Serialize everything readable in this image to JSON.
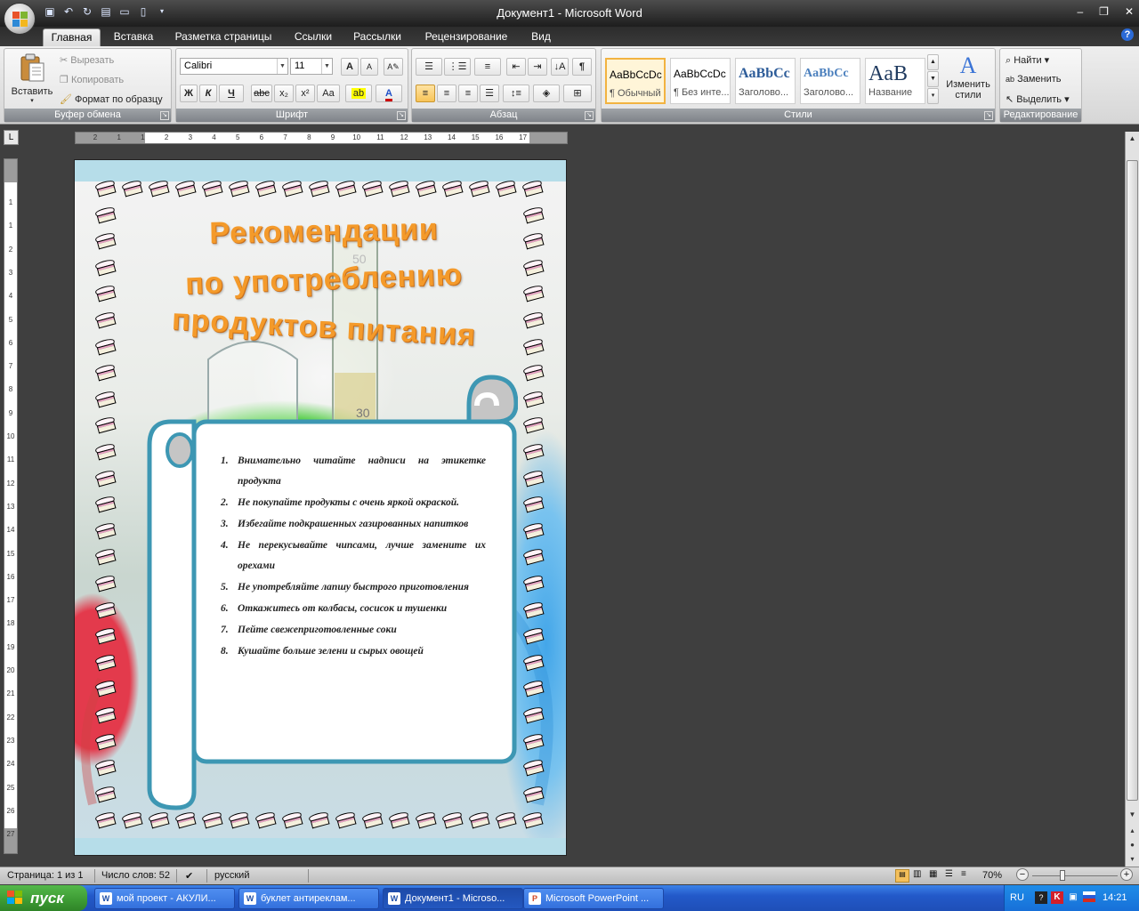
{
  "window": {
    "title": "Документ1 - Microsoft Word",
    "minimize": "–",
    "restore": "❐",
    "close": "✕"
  },
  "qat": {
    "icons": [
      "save-icon",
      "undo-icon",
      "redo-icon",
      "print-icon",
      "open-icon",
      "new-icon"
    ]
  },
  "tabs": [
    "Главная",
    "Вставка",
    "Разметка страницы",
    "Ссылки",
    "Рассылки",
    "Рецензирование",
    "Вид"
  ],
  "ribbon": {
    "clipboard": {
      "paste": "Вставить",
      "cut": "Вырезать",
      "copy": "Копировать",
      "format_painter": "Формат по образцу",
      "label": "Буфер обмена"
    },
    "font": {
      "name": "Calibri",
      "size": "11",
      "label": "Шрифт",
      "bold": "Ж",
      "italic": "К",
      "underline": "Ч",
      "strike": "abc",
      "sub": "x₂",
      "sup": "x²",
      "case": "Aa",
      "grow": "A",
      "shrink": "A"
    },
    "paragraph": {
      "label": "Абзац",
      "pilcrow": "¶"
    },
    "styles": {
      "label": "Стили",
      "items": [
        {
          "preview": "AaBbCcDc",
          "name": "¶ Обычный"
        },
        {
          "preview": "AaBbCcDc",
          "name": "¶ Без инте..."
        },
        {
          "preview": "AaBbCc",
          "name": "Заголово..."
        },
        {
          "preview": "AaBbCc",
          "name": "Заголово..."
        },
        {
          "preview": "AaB",
          "name": "Название"
        }
      ],
      "change": "Изменить стили"
    },
    "editing": {
      "label": "Редактирование",
      "find": "Найти",
      "replace": "Заменить",
      "select": "Выделить"
    }
  },
  "ruler": {
    "h_ticks": [
      "2",
      "1",
      "1",
      "2",
      "3",
      "4",
      "5",
      "6",
      "7",
      "8",
      "9",
      "10",
      "11",
      "12",
      "13",
      "14",
      "15",
      "16",
      "17"
    ],
    "v_ticks": [
      "1",
      "1",
      "2",
      "3",
      "4",
      "5",
      "6",
      "7",
      "8",
      "9",
      "10",
      "11",
      "12",
      "13",
      "14",
      "15",
      "16",
      "17",
      "18",
      "19",
      "20",
      "21",
      "22",
      "23",
      "24",
      "25",
      "26",
      "27"
    ]
  },
  "document": {
    "headline": [
      "Рекомендации",
      "по употреблению",
      "продуктов питания"
    ],
    "list": [
      {
        "num": "1.",
        "text": "Внимательно читайте надписи на этикетке продукта"
      },
      {
        "num": "2.",
        "text": "Не покупайте продукты с очень яркой окраской."
      },
      {
        "num": "3.",
        "text": "Избегайте подкрашенных газированных напитков"
      },
      {
        "num": "4.",
        "text": "Не перекусывайте чипсами, лучше замените их орехами"
      },
      {
        "num": "5.",
        "text": "Не употребляйте лапшу быстрого приготовления"
      },
      {
        "num": "6.",
        "text": "Откажитесь от колбасы, сосисок и тушенки"
      },
      {
        "num": "7.",
        "text": "Пейте свежеприготовленные соки"
      },
      {
        "num": "8.",
        "text": "Кушайте больше зелени и сырых овощей"
      }
    ],
    "beaker_marks": [
      "50",
      "30"
    ]
  },
  "status": {
    "page": "Страница: 1 из 1",
    "words": "Число слов: 52",
    "lang": "русский",
    "zoom": "70%",
    "zoom_level": 0.35
  },
  "taskbar": {
    "start": "пуск",
    "tasks": [
      "мой проект - АКУЛИ...",
      "буклет антиреклам...",
      "Документ1 - Microso...",
      "Microsoft PowerPoint ..."
    ],
    "lang": "RU",
    "time": "14:21"
  },
  "colors": {
    "headline": "#f49a2a",
    "scroll_border": "#3d97b3",
    "page_bg": "#b6dde9"
  }
}
